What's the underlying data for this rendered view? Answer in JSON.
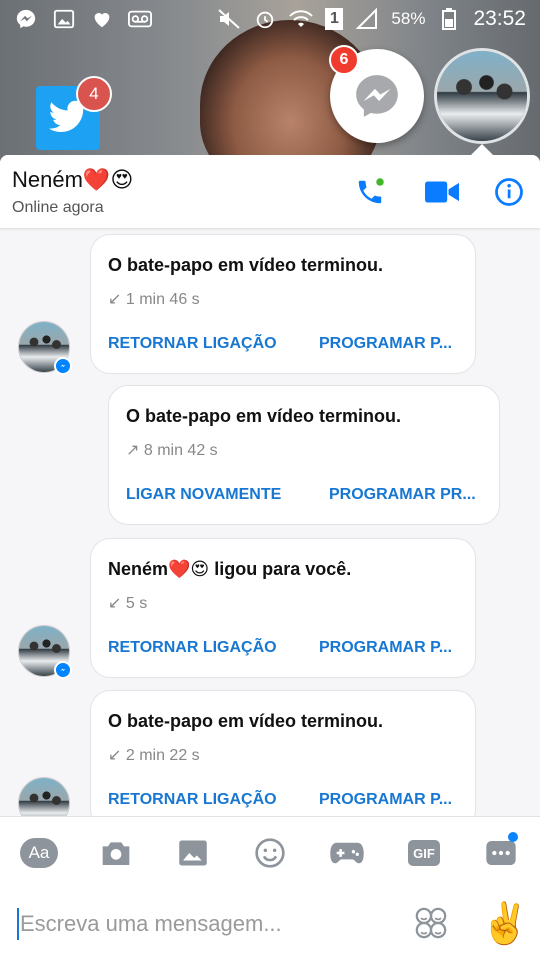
{
  "status_bar": {
    "battery": "58%",
    "time": "23:52",
    "sim_label": "1"
  },
  "floating": {
    "twitter_badge": "4",
    "messenger_badge": "6"
  },
  "header": {
    "name": "Neném❤️😍",
    "status": "Online agora"
  },
  "messages": [
    {
      "title": "O bate-papo em vídeo terminou.",
      "direction": "↙",
      "duration": "1 min 46 s",
      "action_1": "RETORNAR LIGAÇÃO",
      "action_2": "PROGRAMAR P..."
    },
    {
      "title": "O bate-papo em vídeo terminou.",
      "direction": "↗",
      "duration": "8 min 42 s",
      "action_1": "LIGAR NOVAMENTE",
      "action_2": "PROGRAMAR PR..."
    },
    {
      "title": "Neném❤️😍 ligou para você.",
      "direction": "↙",
      "duration": "5 s",
      "action_1": "RETORNAR LIGAÇÃO",
      "action_2": "PROGRAMAR P..."
    },
    {
      "title": "O bate-papo em vídeo terminou.",
      "direction": "↙",
      "duration": "2 min 22 s",
      "action_1": "RETORNAR LIGAÇÃO",
      "action_2": "PROGRAMAR P..."
    }
  ],
  "composer": {
    "aa_label": "Aa",
    "gif_label": "GIF",
    "placeholder": "Escreva uma mensagem...",
    "emoji_button": "✌️"
  },
  "colors": {
    "accent": "#1877d2",
    "messenger_blue": "#0084ff",
    "badge_red": "#f03c2e"
  }
}
